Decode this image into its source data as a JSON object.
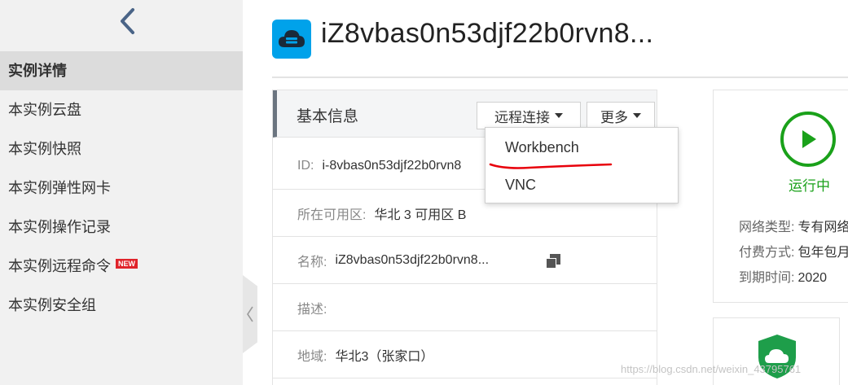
{
  "sidebar": {
    "items": [
      {
        "label": "实例详情",
        "active": true
      },
      {
        "label": "本实例云盘"
      },
      {
        "label": "本实例快照"
      },
      {
        "label": "本实例弹性网卡"
      },
      {
        "label": "本实例操作记录"
      },
      {
        "label": "本实例远程命令",
        "badge": "NEW"
      },
      {
        "label": "本实例安全组"
      }
    ]
  },
  "header": {
    "title": "iZ8vbas0n53djf22b0rvn8..."
  },
  "basic_info": {
    "title": "基本信息",
    "remote_connect_label": "远程连接",
    "more_label": "更多",
    "rows": {
      "id": {
        "label": "ID:",
        "value": "i-8vbas0n53djf22b0rvn8"
      },
      "zone": {
        "label": "所在可用区:",
        "value": "华北 3 可用区 B"
      },
      "name": {
        "label": "名称:",
        "value": "iZ8vbas0n53djf22b0rvn8..."
      },
      "description": {
        "label": "描述:",
        "value": ""
      },
      "region": {
        "label": "地域:",
        "value": "华北3（张家口）"
      }
    }
  },
  "dropdown": {
    "items": [
      "Workbench",
      "VNC"
    ]
  },
  "status": {
    "text": "运行中",
    "network_type": {
      "label": "网络类型:",
      "value": "专有网络"
    },
    "billing": {
      "label": "付费方式:",
      "value": "包年包月"
    },
    "expiry": {
      "label": "到期时间:",
      "value": "2020"
    }
  },
  "watermark": "https://blog.csdn.net/weixin_43795761",
  "colors": {
    "accent_blue": "#00a2ea",
    "running_green": "#1aa11a",
    "annotation_red": "#e8000b",
    "new_badge": "#e0242b"
  }
}
